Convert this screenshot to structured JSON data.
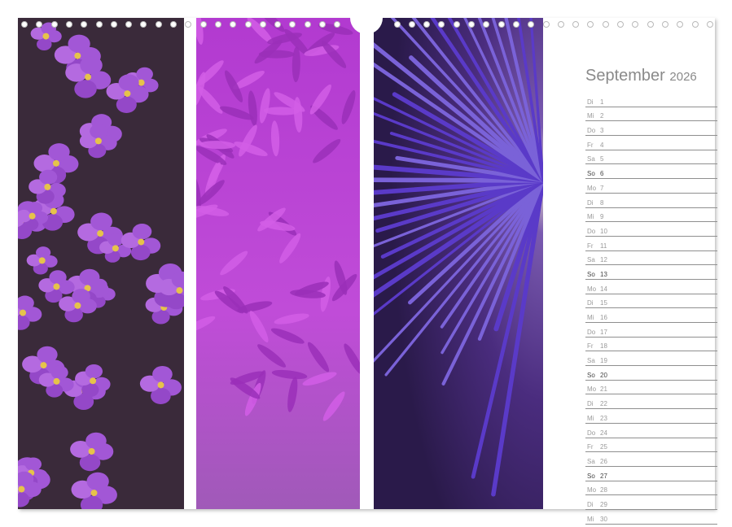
{
  "calendar": {
    "month": "September",
    "year": "2026",
    "days": [
      {
        "wd": "Di",
        "d": "1"
      },
      {
        "wd": "Mi",
        "d": "2"
      },
      {
        "wd": "Do",
        "d": "3"
      },
      {
        "wd": "Fr",
        "d": "4"
      },
      {
        "wd": "Sa",
        "d": "5"
      },
      {
        "wd": "So",
        "d": "6",
        "sun": true
      },
      {
        "wd": "Mo",
        "d": "7"
      },
      {
        "wd": "Di",
        "d": "8"
      },
      {
        "wd": "Mi",
        "d": "9"
      },
      {
        "wd": "Do",
        "d": "10"
      },
      {
        "wd": "Fr",
        "d": "11"
      },
      {
        "wd": "Sa",
        "d": "12"
      },
      {
        "wd": "So",
        "d": "13",
        "sun": true
      },
      {
        "wd": "Mo",
        "d": "14"
      },
      {
        "wd": "Di",
        "d": "15"
      },
      {
        "wd": "Mi",
        "d": "16"
      },
      {
        "wd": "Do",
        "d": "17"
      },
      {
        "wd": "Fr",
        "d": "18"
      },
      {
        "wd": "Sa",
        "d": "19"
      },
      {
        "wd": "So",
        "d": "20",
        "sun": true
      },
      {
        "wd": "Mo",
        "d": "21"
      },
      {
        "wd": "Di",
        "d": "22"
      },
      {
        "wd": "Mi",
        "d": "23"
      },
      {
        "wd": "Do",
        "d": "24"
      },
      {
        "wd": "Fr",
        "d": "25"
      },
      {
        "wd": "Sa",
        "d": "26"
      },
      {
        "wd": "So",
        "d": "27",
        "sun": true
      },
      {
        "wd": "Mo",
        "d": "28"
      },
      {
        "wd": "Di",
        "d": "29"
      },
      {
        "wd": "Mi",
        "d": "30"
      }
    ]
  },
  "photos": [
    {
      "icon": "violet-flowers-photo",
      "accent": "#9b4fc9"
    },
    {
      "icon": "allium-blossom-photo",
      "accent": "#c23fd6"
    },
    {
      "icon": "passionflower-closeup-photo",
      "accent": "#4a2a9a"
    }
  ]
}
